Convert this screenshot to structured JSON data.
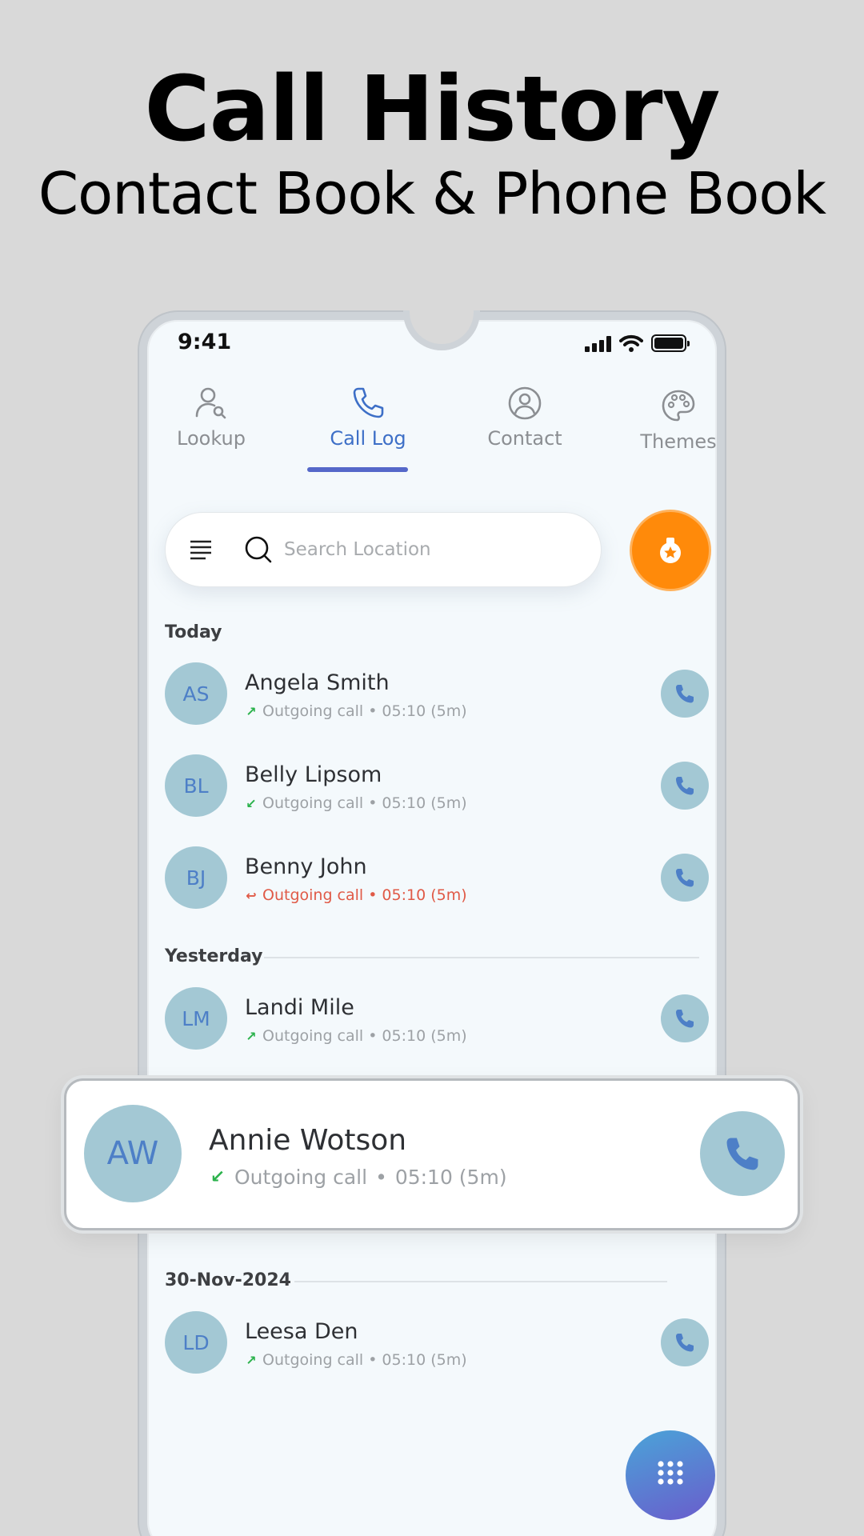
{
  "promo": {
    "title": "Call History",
    "subtitle": "Contact Book & Phone Book"
  },
  "status_bar": {
    "time": "9:41",
    "icons": [
      "signal-icon",
      "wifi-icon",
      "battery-icon"
    ]
  },
  "tabs": [
    {
      "label": "Lookup",
      "icon": "person-search-icon",
      "active": false
    },
    {
      "label": "Call Log",
      "icon": "phone-icon",
      "active": true
    },
    {
      "label": "Contact",
      "icon": "person-circle-icon",
      "active": false
    },
    {
      "label": "Themes",
      "icon": "palette-icon",
      "active": false
    }
  ],
  "search": {
    "placeholder": "Search Location",
    "value": ""
  },
  "sections": {
    "today": "Today",
    "yesterday": "Yesterday",
    "older": "30-Nov-2024"
  },
  "calls": [
    {
      "initials": "AS",
      "name": "Angela Smith",
      "type": "Outgoing call",
      "time": "05:10 (5m)",
      "direction": "outgoing"
    },
    {
      "initials": "BL",
      "name": "Belly Lipsom",
      "type": "Outgoing call",
      "time": "05:10 (5m)",
      "direction": "incoming"
    },
    {
      "initials": "BJ",
      "name": "Benny John",
      "type": "Outgoing call",
      "time": "05:10 (5m)",
      "direction": "missed"
    },
    {
      "initials": "LM",
      "name": "Landi Mile",
      "type": "Outgoing call",
      "time": "05:10 (5m)",
      "direction": "outgoing"
    },
    {
      "initials": "LD",
      "name": "Leesa Den",
      "type": "Outgoing call",
      "time": "05:10 (5m)",
      "direction": "outgoing"
    }
  ],
  "highlight": {
    "initials": "AW",
    "name": "Annie Wotson",
    "type": "Outgoing call",
    "time": "05:10 (5m)",
    "direction": "incoming"
  },
  "separator": "•",
  "colors": {
    "accent": "#3d6fc7",
    "avatar": "#a3c8d4",
    "orange": "#ff8a0a",
    "outgoing": "#2bb24c",
    "missed": "#e05a47"
  }
}
